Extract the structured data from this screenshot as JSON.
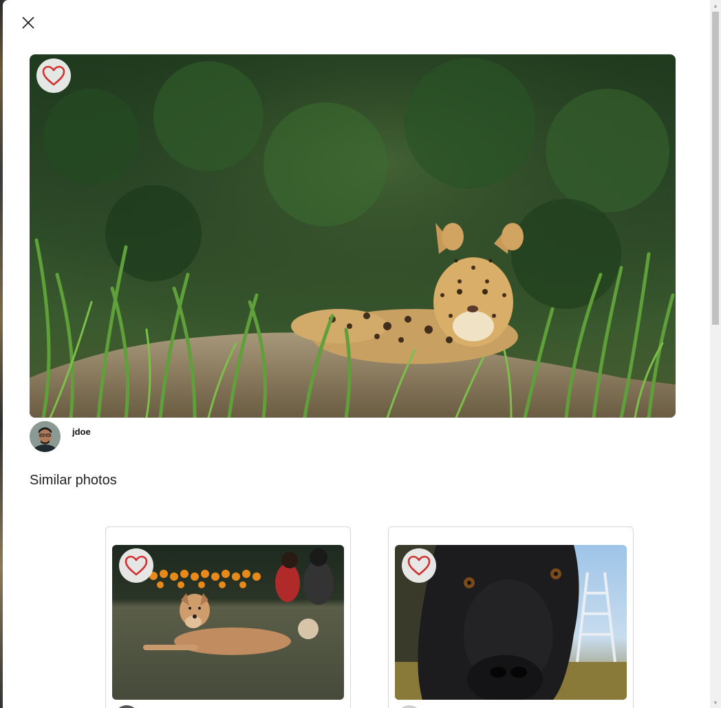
{
  "modal": {
    "close_icon": "close-icon",
    "favorite_icon": "heart-outline-icon",
    "accent_color": "#d32f2f"
  },
  "main_photo": {
    "subject": "jaguar"
  },
  "author": {
    "username": "jdoe"
  },
  "similar": {
    "title": "Similar photos",
    "items": [
      {
        "subject": "dog-lying-on-grass"
      },
      {
        "subject": "black-dog-closeup"
      }
    ]
  }
}
